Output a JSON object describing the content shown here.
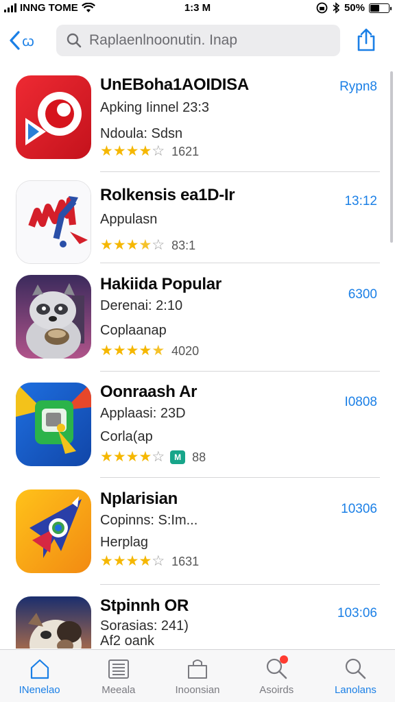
{
  "status_bar": {
    "carrier": "INNG TOME",
    "time": "1:3 M",
    "battery": "50%",
    "battery_level": 0.5
  },
  "nav": {
    "back_label": "ꞷ",
    "search_text": "Raplaenlnoonutin. Inap"
  },
  "apps": [
    {
      "name": "UnEBoha1AOIDISA",
      "line1": "Apking  Iinnel 23:3",
      "line2": "Ndoula: Sdsn",
      "stars": [
        1,
        1,
        1,
        1,
        0
      ],
      "count": "1621",
      "action": "Rypn8",
      "icon": "red-swirl-app-icon"
    },
    {
      "name": "Rolkensis ea1D-Ir",
      "line1": "Appulasn",
      "line2": "",
      "stars": [
        1,
        1,
        1,
        0.5,
        0
      ],
      "count": "83:1",
      "action": "13:12",
      "icon": "red-blue-graph-app-icon"
    },
    {
      "name": "Hakiida Popular",
      "line1": "Derenai: 2:10",
      "line2": "Coplaanap",
      "stars": [
        1,
        1,
        1,
        1,
        0.5
      ],
      "count": "4020",
      "action": "6300",
      "icon": "raccoon-mascot-app-icon"
    },
    {
      "name": "Oonraash Ar",
      "line1": "Applaasi: 23D",
      "line2": "Corla(ap",
      "stars": [
        1,
        1,
        1,
        1,
        0
      ],
      "count": "88",
      "action": "I0808",
      "icon": "green-megaphone-app-icon",
      "badge": "M"
    },
    {
      "name": "Nplarisian",
      "line1": "Copinns: S:Im...",
      "line2": "Herplag",
      "stars": [
        1,
        1,
        1,
        1,
        0
      ],
      "count": "1631",
      "action": "10306",
      "icon": "rocket-bird-app-icon"
    },
    {
      "name": "Stpinnh OR",
      "line1": "Sorasias: 241)",
      "line2": "Af2 oank",
      "stars": [],
      "count": "",
      "action": "103:06",
      "icon": "dog-mascot-app-icon"
    }
  ],
  "tabs": [
    {
      "label": "INenelao",
      "icon": "home-icon",
      "active": true
    },
    {
      "label": "Meeala",
      "icon": "list-icon",
      "active": false
    },
    {
      "label": "Inoonsian",
      "icon": "bag-icon",
      "active": false
    },
    {
      "label": "Asoirds",
      "icon": "search-notify-icon",
      "active": false
    },
    {
      "label": "Lanolans",
      "icon": "search-icon",
      "active": false
    }
  ],
  "colors": {
    "accent": "#1a7fe6",
    "star": "#f5b700",
    "tab_bg": "#f7f7f8"
  }
}
